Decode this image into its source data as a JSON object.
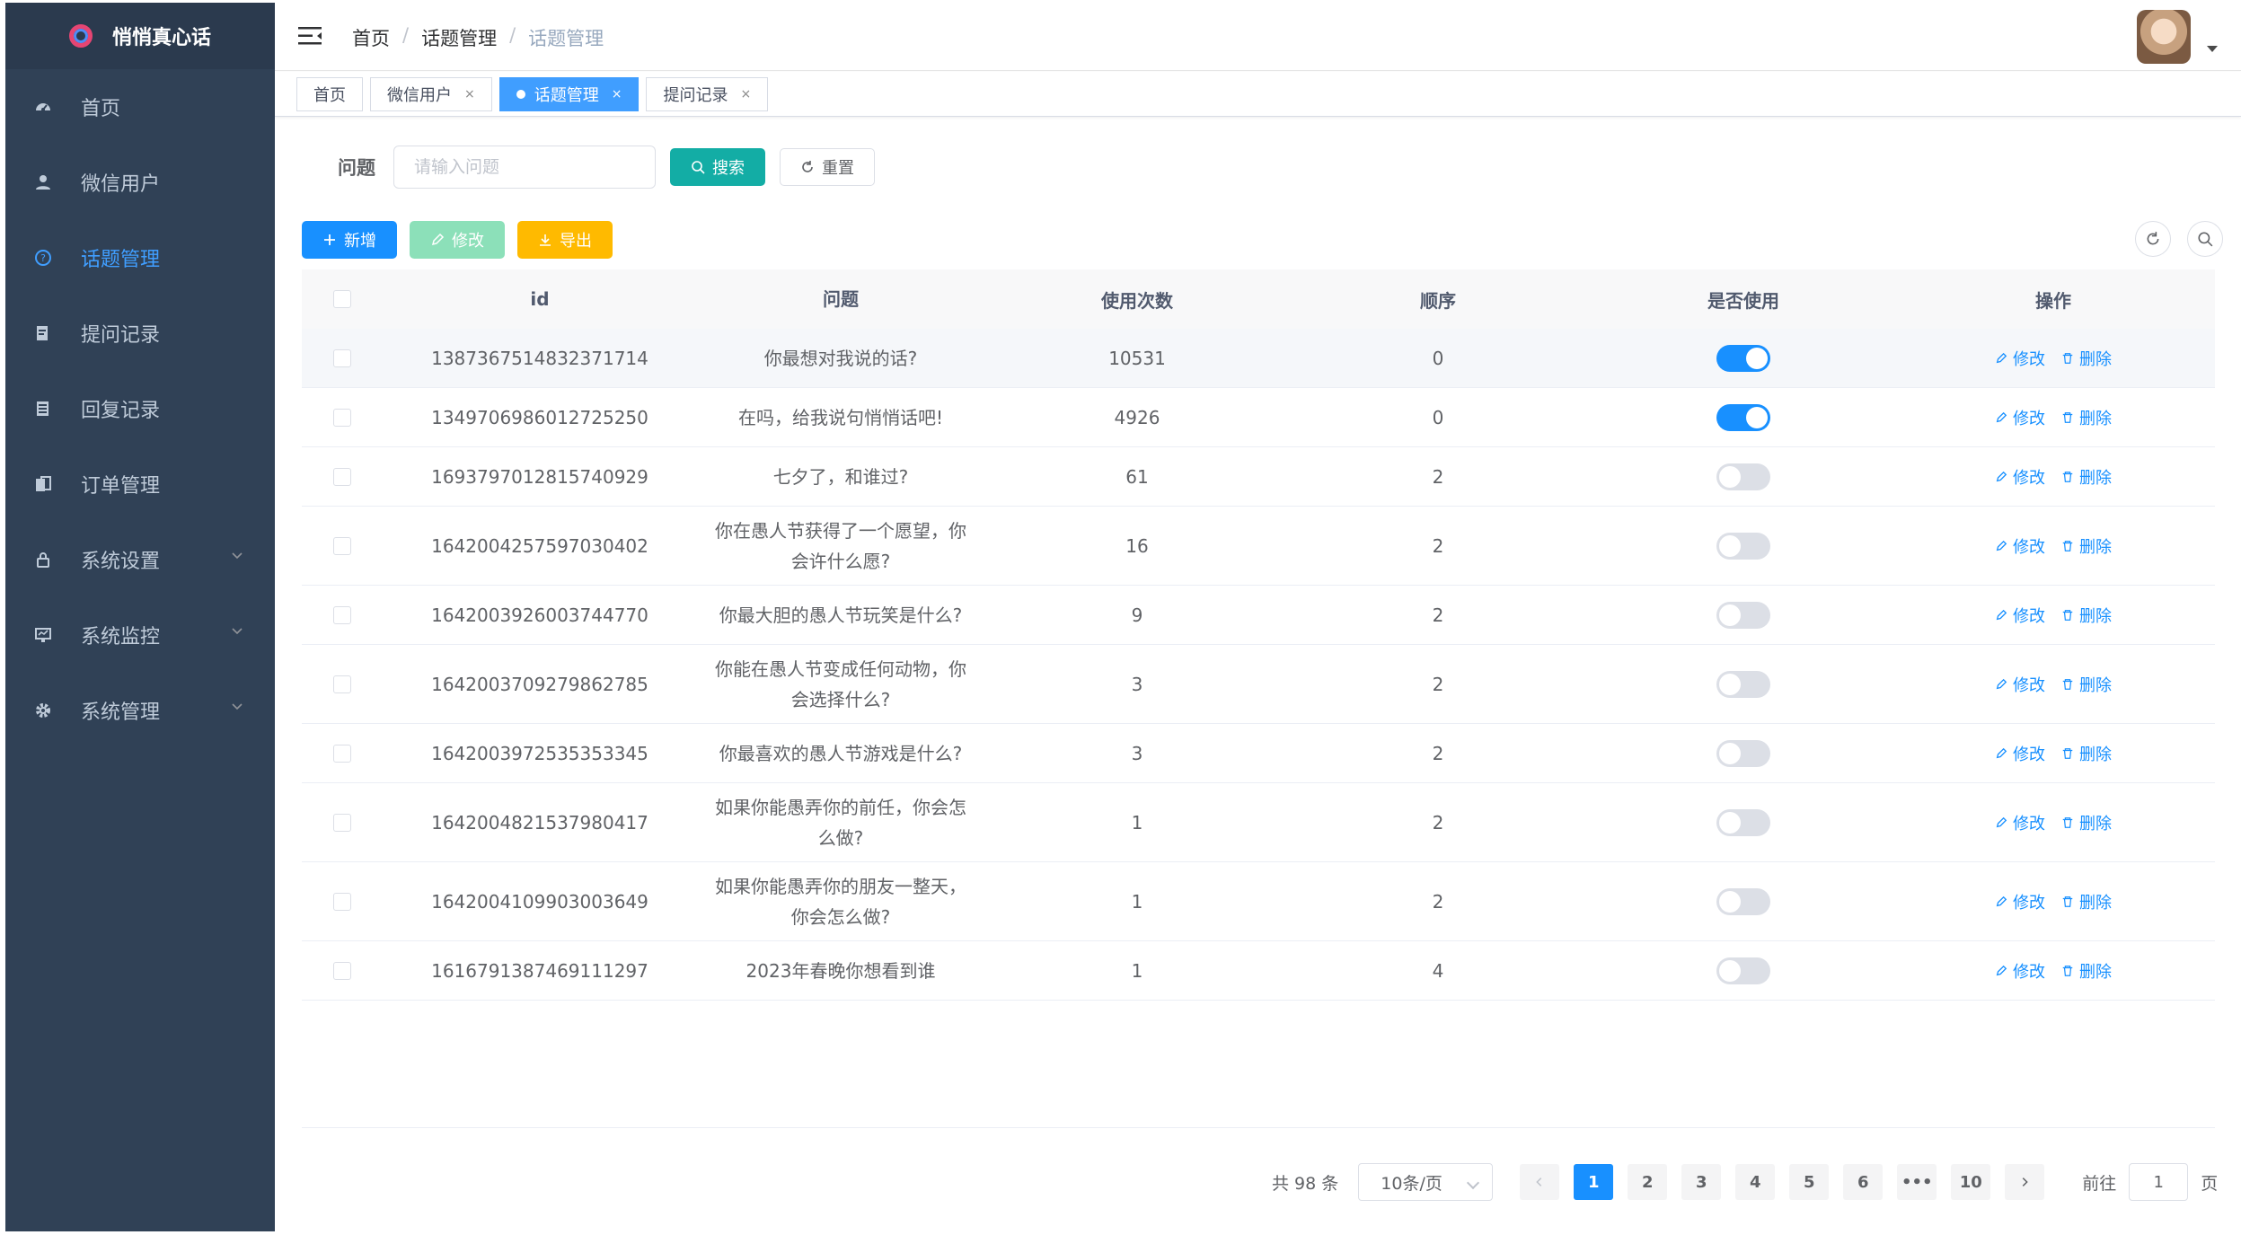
{
  "app": {
    "title": "悄悄真心话"
  },
  "sidebar": {
    "items": [
      {
        "label": "首页",
        "icon": "dashboard-icon"
      },
      {
        "label": "微信用户",
        "icon": "user-icon"
      },
      {
        "label": "话题管理",
        "icon": "question-icon",
        "active": true
      },
      {
        "label": "提问记录",
        "icon": "edit-doc-icon"
      },
      {
        "label": "回复记录",
        "icon": "doc-icon"
      },
      {
        "label": "订单管理",
        "icon": "clipboard-icon"
      },
      {
        "label": "系统设置",
        "icon": "lock-icon",
        "has_children": true
      },
      {
        "label": "系统监控",
        "icon": "monitor-icon",
        "has_children": true
      },
      {
        "label": "系统管理",
        "icon": "gear-icon",
        "has_children": true
      }
    ]
  },
  "breadcrumb": [
    "首页",
    "话题管理",
    "话题管理"
  ],
  "tags": [
    {
      "label": "首页"
    },
    {
      "label": "微信用户"
    },
    {
      "label": "话题管理",
      "active": true
    },
    {
      "label": "提问记录"
    }
  ],
  "search": {
    "label": "问题",
    "placeholder": "请输入问题",
    "search_button": "搜索",
    "reset_button": "重置"
  },
  "toolbar": {
    "add": "新增",
    "edit": "修改",
    "export": "导出"
  },
  "table": {
    "headers": [
      "id",
      "问题",
      "使用次数",
      "顺序",
      "是否使用",
      "操作"
    ],
    "edit_label": "修改",
    "delete_label": "删除",
    "rows": [
      {
        "id": "1387367514832371714",
        "question": "你最想对我说的话?",
        "count": "10531",
        "order": "0",
        "enabled": true
      },
      {
        "id": "1349706986012725250",
        "question": "在吗，给我说句悄悄话吧!",
        "count": "4926",
        "order": "0",
        "enabled": true
      },
      {
        "id": "1693797012815740929",
        "question": "七夕了，和谁过?",
        "count": "61",
        "order": "2",
        "enabled": false
      },
      {
        "id": "1642004257597030402",
        "question": "你在愚人节获得了一个愿望，你会许什么愿?",
        "count": "16",
        "order": "2",
        "enabled": false
      },
      {
        "id": "1642003926003744770",
        "question": "你最大胆的愚人节玩笑是什么?",
        "count": "9",
        "order": "2",
        "enabled": false
      },
      {
        "id": "1642003709279862785",
        "question": "你能在愚人节变成任何动物，你会选择什么?",
        "count": "3",
        "order": "2",
        "enabled": false
      },
      {
        "id": "1642003972535353345",
        "question": "你最喜欢的愚人节游戏是什么?",
        "count": "3",
        "order": "2",
        "enabled": false
      },
      {
        "id": "1642004821537980417",
        "question": "如果你能愚弄你的前任，你会怎么做?",
        "count": "1",
        "order": "2",
        "enabled": false
      },
      {
        "id": "1642004109903003649",
        "question": "如果你能愚弄你的朋友一整天，你会怎么做?",
        "count": "1",
        "order": "2",
        "enabled": false
      },
      {
        "id": "1616791387469111297",
        "question": "2023年春晚你想看到谁",
        "count": "1",
        "order": "4",
        "enabled": false
      }
    ]
  },
  "pagination": {
    "total": "共 98 条",
    "page_size": "10条/页",
    "pages": [
      "1",
      "2",
      "3",
      "4",
      "5",
      "6",
      "•••",
      "10"
    ],
    "current": "1",
    "goto_prefix": "前往",
    "goto_value": "1",
    "goto_suffix": "页"
  },
  "colors": {
    "primary": "#1890ff",
    "sidebar": "#304156",
    "search": "#13ada5",
    "edit": "#8ce0b9",
    "export": "#ffba00"
  }
}
